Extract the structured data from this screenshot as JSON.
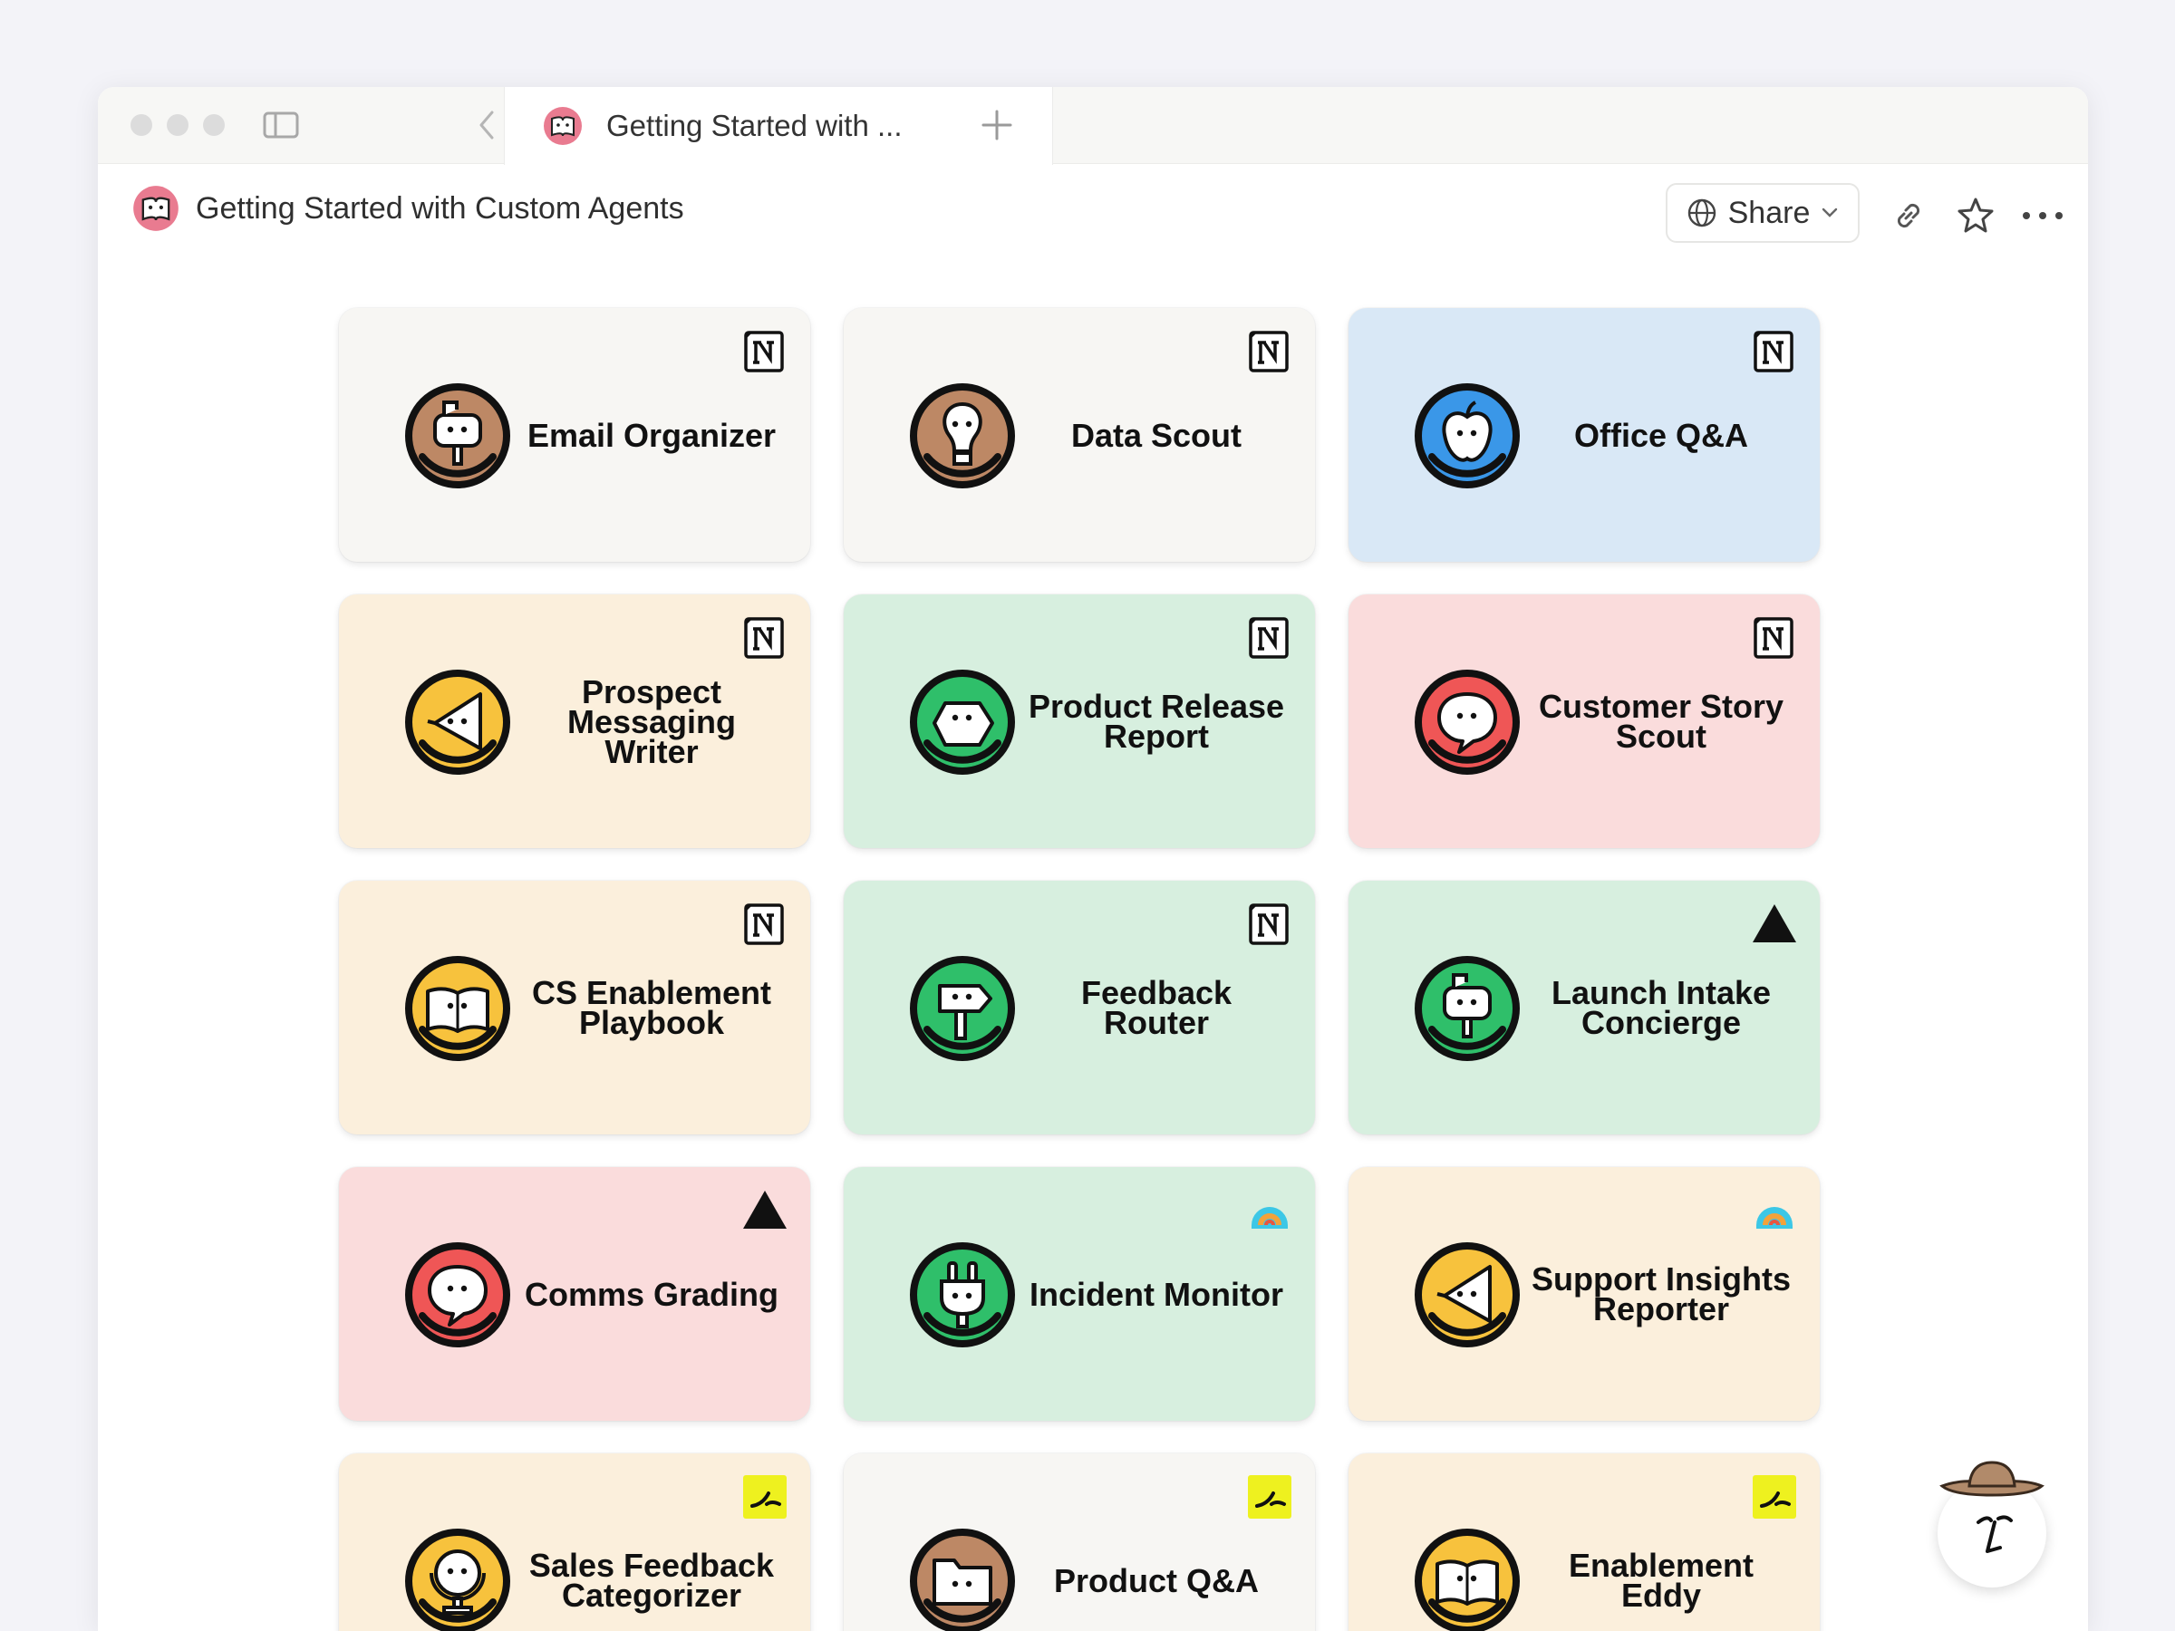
{
  "tab": {
    "title": "Getting Started with ..."
  },
  "page": {
    "title": "Getting Started with Custom Agents"
  },
  "toolbar": {
    "share_label": "Share"
  },
  "cards": [
    {
      "label": "Email Organizer",
      "bg": "#f7f6f3",
      "icon": "mailbox",
      "icon_color": "#bd8865",
      "badge": "notion"
    },
    {
      "label": "Data Scout",
      "bg": "#f7f6f3",
      "icon": "lightbulb",
      "icon_color": "#bd8865",
      "badge": "notion"
    },
    {
      "label": "Office Q&A",
      "bg": "#d9e8f6",
      "icon": "apple",
      "icon_color": "#3a97e8",
      "badge": "notion"
    },
    {
      "label": "Prospect Messaging Writer",
      "bg": "#fbefdc",
      "icon": "megaphone",
      "icon_color": "#f7c23d",
      "badge": "notion"
    },
    {
      "label": "Product Release Report",
      "bg": "#d7efdf",
      "icon": "hexagon",
      "icon_color": "#2fbf6a",
      "badge": "notion"
    },
    {
      "label": "Customer Story Scout",
      "bg": "#fadcdc",
      "icon": "chat",
      "icon_color": "#ef5656",
      "badge": "notion"
    },
    {
      "label": "CS Enablement Playbook",
      "bg": "#fbefdc",
      "icon": "book",
      "icon_color": "#f7c23d",
      "badge": "notion"
    },
    {
      "label": "Feedback Router",
      "bg": "#d7efdf",
      "icon": "signpost",
      "icon_color": "#2fbf6a",
      "badge": "notion"
    },
    {
      "label": "Launch Intake Concierge",
      "bg": "#d7efdf",
      "icon": "mailbox",
      "icon_color": "#2fbf6a",
      "badge": "triangle"
    },
    {
      "label": "Comms Grading",
      "bg": "#fadcdc",
      "icon": "chat",
      "icon_color": "#ef5656",
      "badge": "triangle"
    },
    {
      "label": "Incident Monitor",
      "bg": "#d7efdf",
      "icon": "plug",
      "icon_color": "#2fbf6a",
      "badge": "rainbow"
    },
    {
      "label": "Support Insights Reporter",
      "bg": "#fbefdc",
      "icon": "megaphone",
      "icon_color": "#f7c23d",
      "badge": "rainbow"
    },
    {
      "label": "Sales Feedback Categorizer",
      "bg": "#fbefdc",
      "icon": "globe",
      "icon_color": "#f7c23d",
      "badge": "sprout"
    },
    {
      "label": "Product Q&A",
      "bg": "#f7f6f3",
      "icon": "folder",
      "icon_color": "#bd8865",
      "badge": "sprout"
    },
    {
      "label": "Enablement Eddy",
      "bg": "#fbefdc",
      "icon": "book",
      "icon_color": "#f7c23d",
      "badge": "sprout"
    }
  ]
}
